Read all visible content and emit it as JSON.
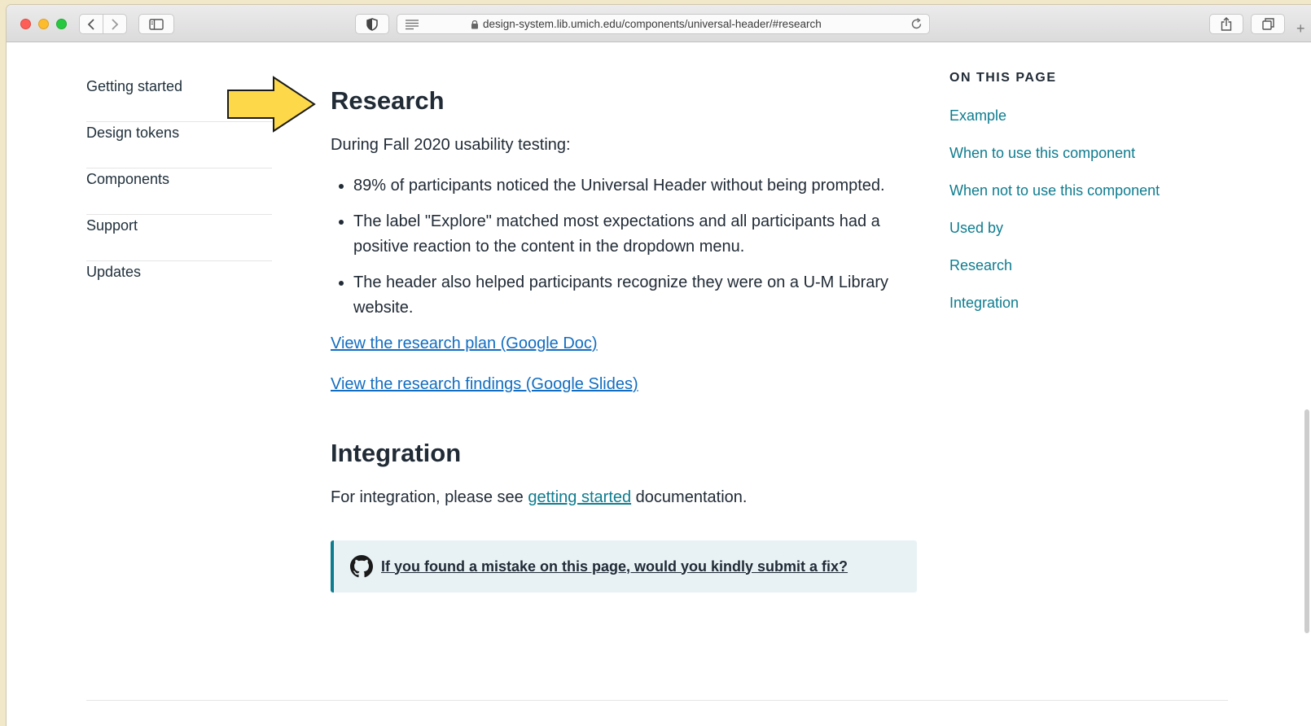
{
  "browser": {
    "url": "design-system.lib.umich.edu/components/universal-header/#research",
    "new_tab": "+"
  },
  "leftnav": {
    "items": [
      "Getting started",
      "Design tokens",
      "Components",
      "Support",
      "Updates"
    ]
  },
  "research": {
    "heading": "Research",
    "intro": "During Fall 2020 usability testing:",
    "bullets": [
      "89% of participants noticed the Universal Header without being prompted.",
      "The label \"Explore\" matched most expectations and all participants had a positive reaction to the content in the dropdown menu.",
      "The header also helped participants recognize they were on a U-M Library website."
    ],
    "plan_link": "View the research plan (Google Doc)",
    "findings_link": "View the research findings (Google Slides)"
  },
  "integration": {
    "heading": "Integration",
    "text_before": "For integration, please see ",
    "link": "getting started",
    "text_after": " documentation."
  },
  "fix_box": {
    "link": "If you found a mistake on this page, would you kindly submit a fix?"
  },
  "on_this_page": {
    "title": "ON THIS PAGE",
    "links": [
      "Example",
      "When to use this component",
      "When not to use this component",
      "Used by",
      "Research",
      "Integration"
    ]
  },
  "colors": {
    "accent_teal": "#0e7c8f",
    "arrow_fill": "#fdd94a",
    "text_dark": "#212b36"
  }
}
